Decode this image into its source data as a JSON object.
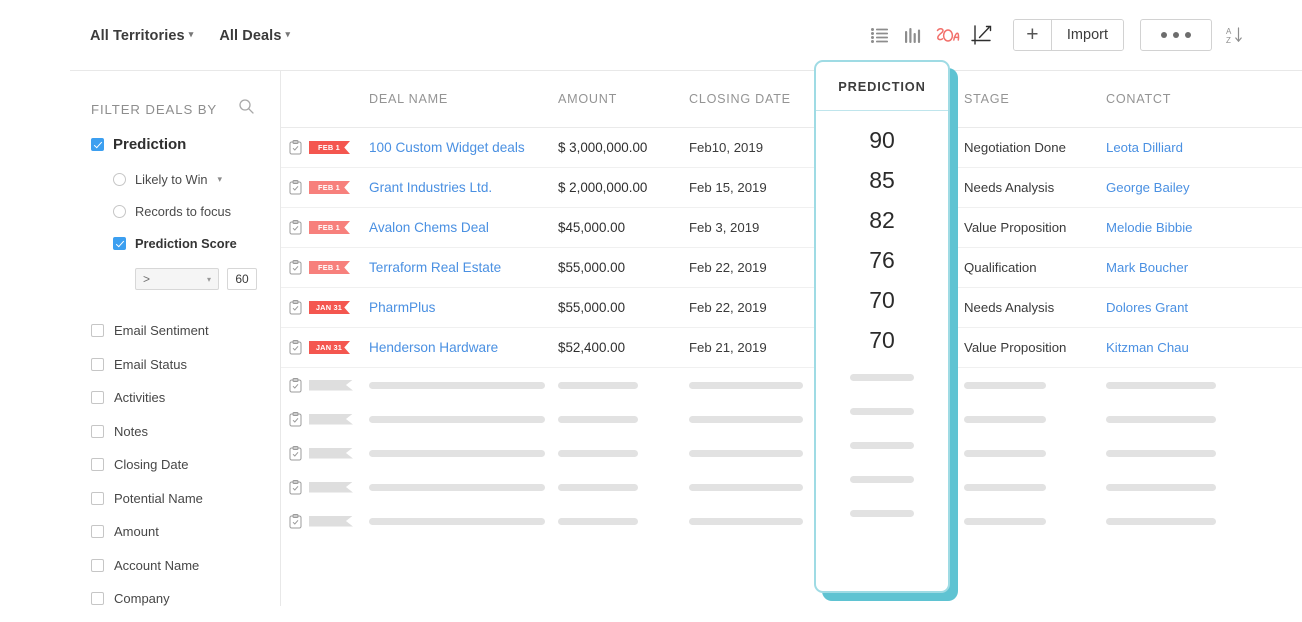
{
  "topbar": {
    "territory_filter": "All Territories",
    "deals_filter": "All Deals",
    "icons": [
      {
        "name": "list-view-icon",
        "label": "List View"
      },
      {
        "name": "kanban-view-icon",
        "label": "Kanban View"
      },
      {
        "name": "zia-icon",
        "label": "Zia"
      },
      {
        "name": "chart-view-icon",
        "label": "Chart View"
      }
    ],
    "add_label": "+",
    "import_label": "Import",
    "more_label": "•••",
    "sort_label": "A-Z"
  },
  "sidebar": {
    "title": "FILTER DEALS BY",
    "search_icon": "search-icon",
    "prediction": {
      "label": "Prediction",
      "checked": true,
      "options": [
        {
          "label": "Likely to Win",
          "type": "radio",
          "checked": false,
          "caret": true
        },
        {
          "label": "Records to focus",
          "type": "radio",
          "checked": false,
          "caret": false
        },
        {
          "label": "Prediction Score",
          "type": "checkbox",
          "checked": true,
          "caret": false
        }
      ],
      "score_operator": ">",
      "score_value": "60"
    },
    "filters": [
      {
        "label": "Email Sentiment",
        "checked": false
      },
      {
        "label": "Email Status",
        "checked": false
      },
      {
        "label": "Activities",
        "checked": false
      },
      {
        "label": "Notes",
        "checked": false
      },
      {
        "label": "Closing Date",
        "checked": false
      },
      {
        "label": "Potential Name",
        "checked": false
      },
      {
        "label": "Amount",
        "checked": false
      },
      {
        "label": "Account Name",
        "checked": false
      },
      {
        "label": "Company",
        "checked": false
      }
    ]
  },
  "table": {
    "columns": [
      "",
      "DEAL NAME",
      "AMOUNT",
      "CLOSING DATE",
      "STAGE",
      "CONATCT"
    ],
    "prediction_column_header": "PREDICTION",
    "rows": [
      {
        "tag": "FEB 1",
        "tag_dim": false,
        "deal_name": "100 Custom Widget deals",
        "amount": "$ 3,000,000.00",
        "closing_date": "Feb10, 2019",
        "prediction": "90",
        "stage": "Negotiation Done",
        "contact": "Leota Dilliard"
      },
      {
        "tag": "FEB 1",
        "tag_dim": true,
        "deal_name": "Grant Industries Ltd.",
        "amount": "$ 2,000,000.00",
        "closing_date": "Feb 15, 2019",
        "prediction": "85",
        "stage": "Needs Analysis",
        "contact": "George Bailey"
      },
      {
        "tag": "FEB 1",
        "tag_dim": true,
        "deal_name": "Avalon Chems Deal",
        "amount": "$45,000.00",
        "closing_date": "Feb 3, 2019",
        "prediction": "82",
        "stage": "Value Proposition",
        "contact": "Melodie Bibbie"
      },
      {
        "tag": "FEB 1",
        "tag_dim": true,
        "deal_name": "Terraform Real Estate",
        "amount": "$55,000.00",
        "closing_date": "Feb 22, 2019",
        "prediction": "76",
        "stage": "Qualification",
        "contact": "Mark Boucher"
      },
      {
        "tag": "JAN 31",
        "tag_dim": false,
        "deal_name": "PharmPlus",
        "amount": "$55,000.00",
        "closing_date": "Feb 22, 2019",
        "prediction": "70",
        "stage": "Needs Analysis",
        "contact": "Dolores Grant"
      },
      {
        "tag": "JAN 31",
        "tag_dim": false,
        "deal_name": "Henderson Hardware",
        "amount": "$52,400.00",
        "closing_date": "Feb 21, 2019",
        "prediction": "70",
        "stage": "Value Proposition",
        "contact": "Kitzman Chau"
      }
    ],
    "skeleton_row_count": 5
  },
  "colors": {
    "accent_teal": "#5fc3d2",
    "link_blue": "#4a90e2",
    "checkbox_blue": "#3c9ff0",
    "tag_red": "#f4564f",
    "zia_red": "#f2706b"
  }
}
